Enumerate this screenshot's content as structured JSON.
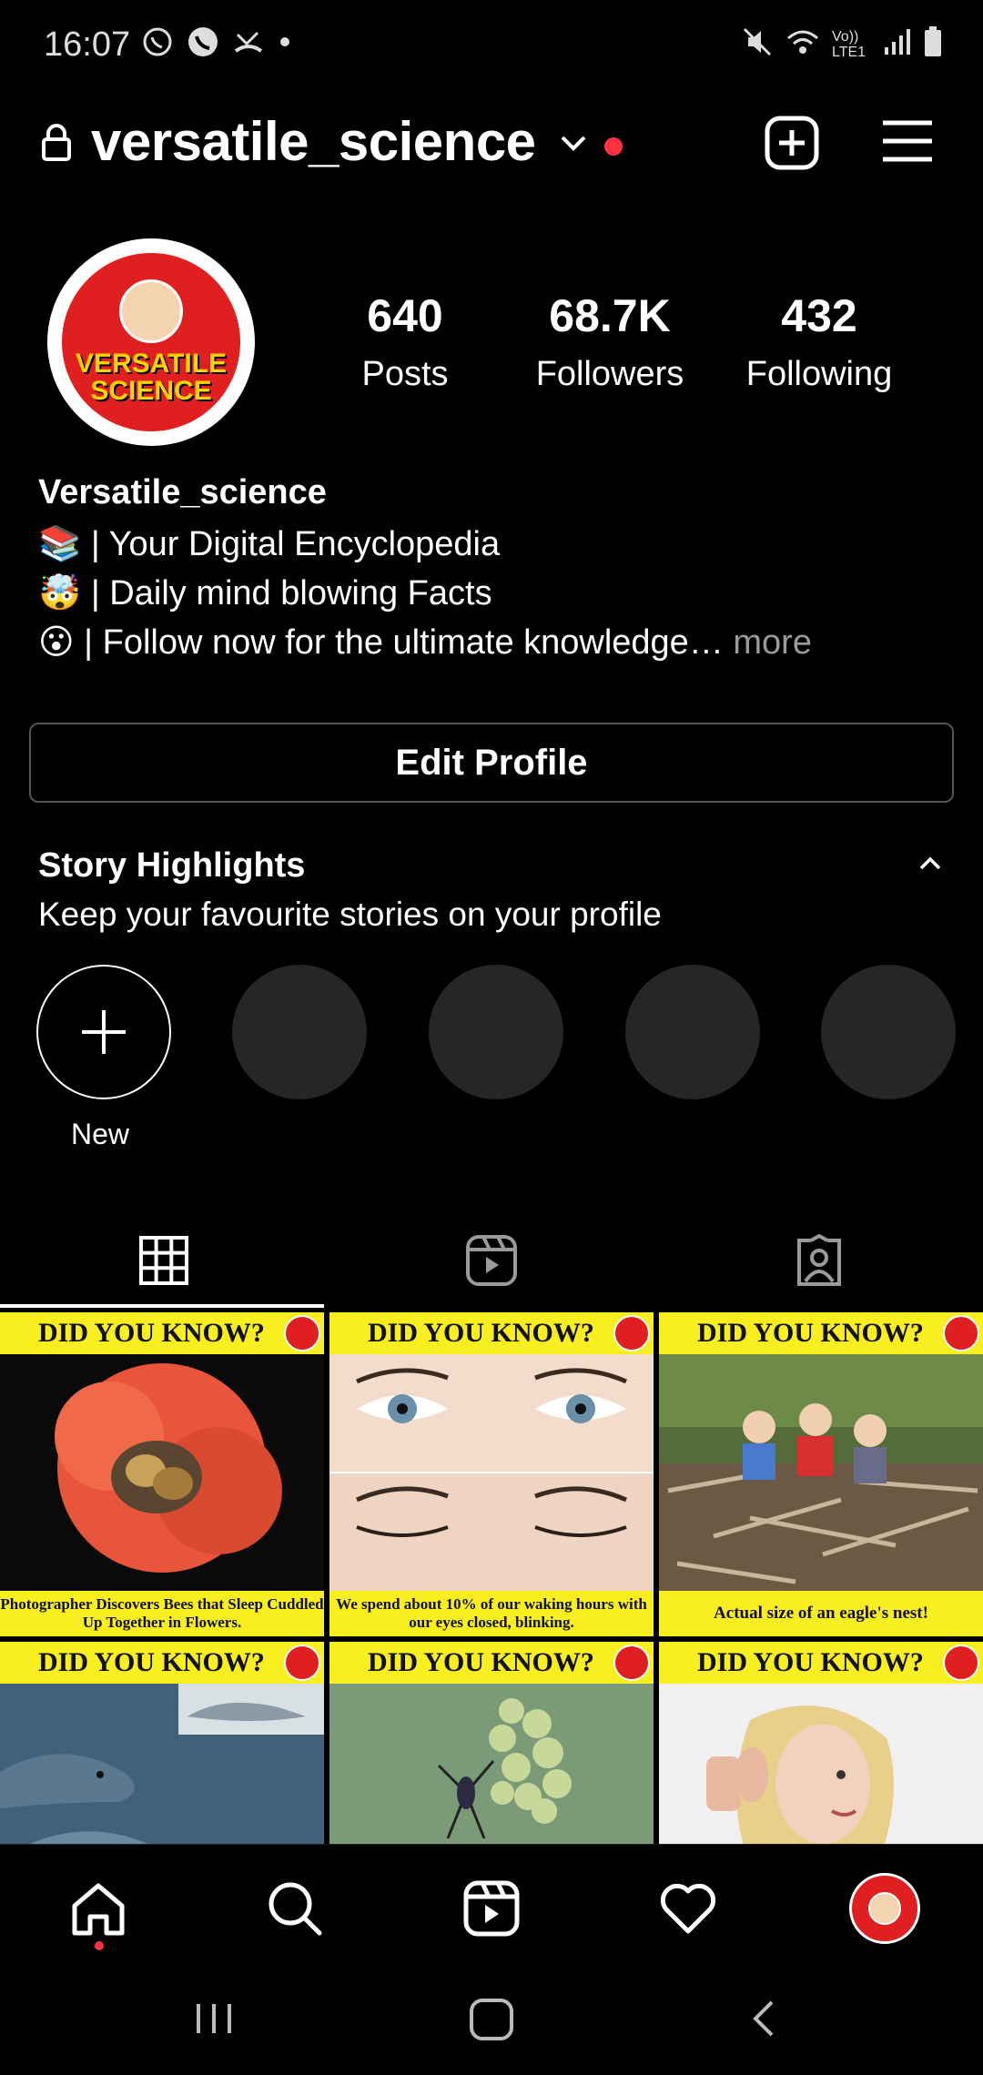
{
  "status_bar": {
    "time": "16:07",
    "lte_label": "Vo)) LTE1"
  },
  "header": {
    "username": "versatile_science"
  },
  "profile": {
    "avatar_text": "VERSATILE SCIENCE",
    "stats": [
      {
        "value": "640",
        "label": "Posts"
      },
      {
        "value": "68.7K",
        "label": "Followers"
      },
      {
        "value": "432",
        "label": "Following"
      }
    ],
    "name": "Versatile_science",
    "bio_lines": [
      "📚 | Your Digital Encyclopedia",
      "🤯 | Daily mind blowing Facts",
      "😮 | Follow now for the ultimate knowledge…"
    ],
    "bio_more": "more",
    "edit_button": "Edit Profile"
  },
  "highlights": {
    "title": "Story Highlights",
    "subtitle": "Keep your favourite stories on your profile",
    "new_label": "New"
  },
  "posts": [
    {
      "banner": "DID YOU KNOW?",
      "caption": "Photographer Discovers Bees that Sleep Cuddled Up Together in Flowers."
    },
    {
      "banner": "DID YOU KNOW?",
      "caption": "We spend about 10% of our waking hours with our eyes closed, blinking."
    },
    {
      "banner": "DID YOU KNOW?",
      "caption": "Actual size of an eagle's nest!"
    },
    {
      "banner": "DID YOU KNOW?",
      "caption": ""
    },
    {
      "banner": "DID YOU KNOW?",
      "caption": ""
    },
    {
      "banner": "DID YOU KNOW?",
      "caption": ""
    }
  ],
  "icons": {
    "lock": "lock-icon",
    "add": "plus-square-icon",
    "menu": "hamburger-icon",
    "grid": "grid-icon",
    "reels": "reels-icon",
    "tagged": "tagged-person-icon",
    "home": "home-icon",
    "search": "search-icon",
    "heart": "heart-icon"
  },
  "colors": {
    "background": "#000000",
    "accent_red": "#ff3040",
    "banner_yellow": "#f8ee20",
    "highlight_gray": "#262626"
  }
}
